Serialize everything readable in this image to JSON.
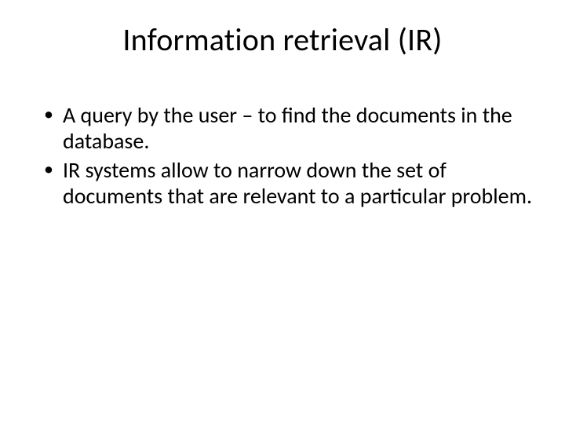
{
  "slide": {
    "title": "Information retrieval (IR)",
    "bullets": [
      "A query by the user – to find the documents in the database.",
      "IR systems allow to narrow down the set of documents that are relevant to a particular problem."
    ]
  }
}
